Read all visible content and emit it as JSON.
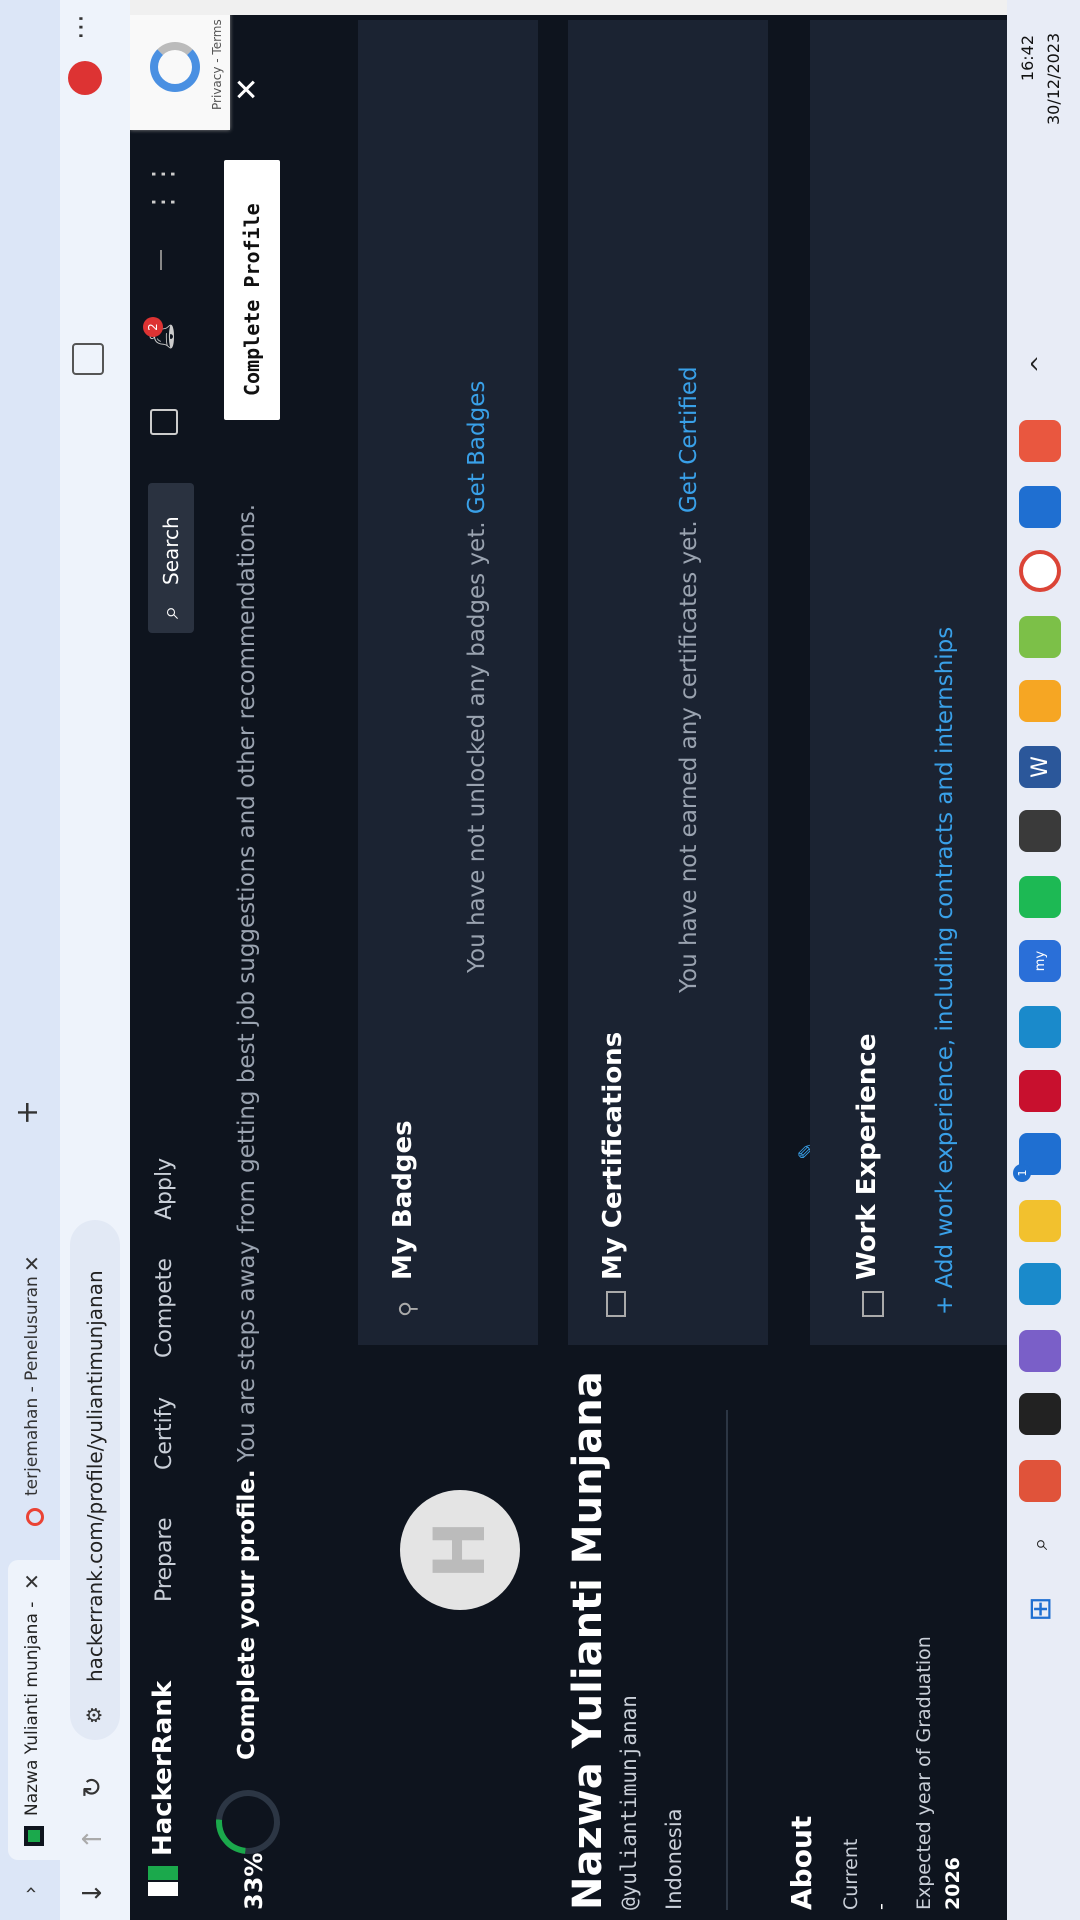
{
  "browser": {
    "tabs": [
      {
        "title": "Nazwa Yulianti munjana - yulian",
        "favicon": "hackerrank-icon"
      },
      {
        "title": "terjemahan - Penelusuran Goog",
        "favicon": "google-icon"
      }
    ],
    "url": "hackerrank.com/profile/yuliantimunjanan"
  },
  "nav": {
    "brand": "HackerRank",
    "items": [
      "Prepare",
      "Certify",
      "Compete",
      "Apply"
    ],
    "search_label": "Search",
    "notification_count": "2"
  },
  "banner": {
    "percent": "33%",
    "progress_fraction": 0.33,
    "bold_text": "Complete your profile.",
    "text": " You are steps away from getting best job suggestions and other recommendations.",
    "button": "Complete Profile"
  },
  "profile": {
    "name": "Nazwa Yulianti Munjana",
    "username": "@yuliantimunjanan",
    "country": "Indonesia",
    "about_title": "About",
    "current_label": "Current",
    "current_value": "-",
    "grad_label": "Expected year of Graduation",
    "grad_value": "2026"
  },
  "sections": {
    "badges_title": "My Badges",
    "badges_empty": "You have not unlocked any badges yet.",
    "badges_link": "Get Badges",
    "certs_title": "My Certifications",
    "certs_empty": "You have not earned any certificates yet.",
    "certs_link": "Get Certified",
    "work_title": "Work Experience",
    "work_link": "+ Add work experience, including contracts and internships"
  },
  "recaptcha": {
    "text": "Privacy - Terms"
  },
  "system": {
    "time": "16:42",
    "date": "30/12/2023",
    "taskbar_badge": "1"
  }
}
